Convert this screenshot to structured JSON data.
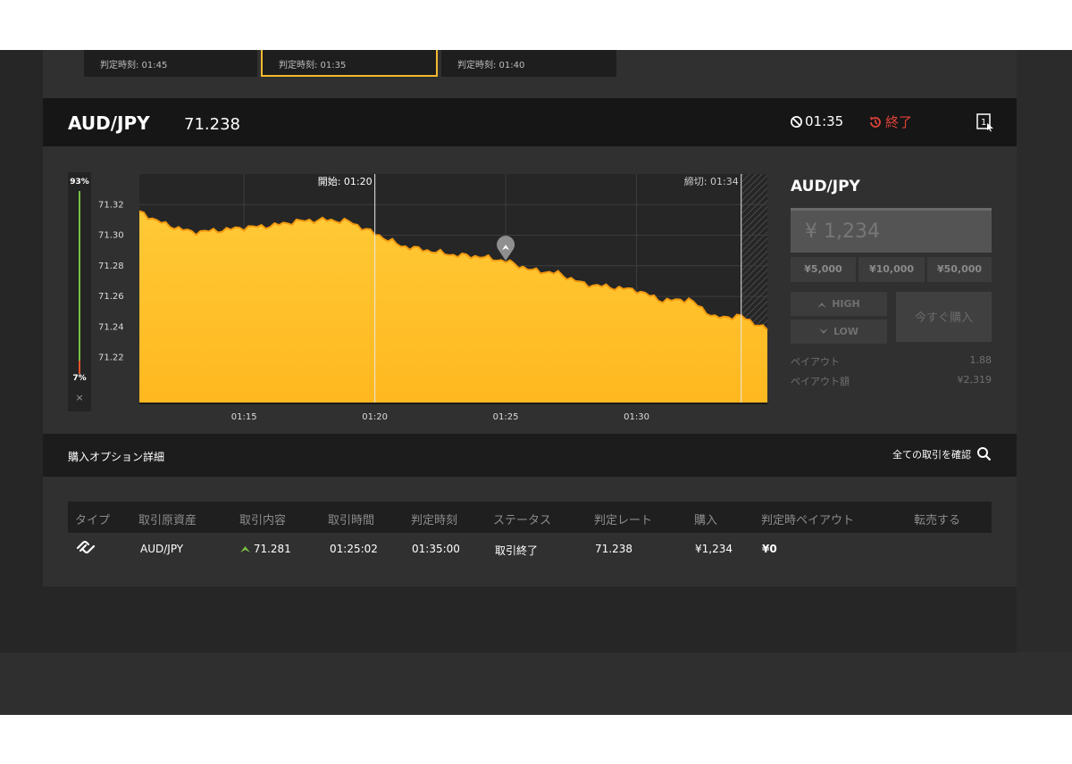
{
  "cards": [
    {
      "label": "判定時刻: 01:45"
    },
    {
      "label": "判定時刻: 01:35",
      "active": true
    },
    {
      "label": "判定時刻: 01:40"
    }
  ],
  "header": {
    "pair": "AUD/JPY",
    "price": "71.238",
    "timer": "01:35",
    "status": "終了",
    "status_color": "#e0433a"
  },
  "gauge": {
    "high_pct": "93%",
    "low_pct": "7%",
    "close": "×"
  },
  "chart_data": {
    "type": "area",
    "x": [
      "01:11",
      "01:12",
      "01:13",
      "01:14",
      "01:15",
      "01:16",
      "01:17",
      "01:18",
      "01:19",
      "01:20",
      "01:21",
      "01:22",
      "01:23",
      "01:24",
      "01:25",
      "01:26",
      "01:27",
      "01:28",
      "01:29",
      "01:30",
      "01:31",
      "01:32",
      "01:33",
      "01:34",
      "01:35"
    ],
    "values": [
      71.315,
      71.307,
      71.302,
      71.303,
      71.305,
      71.306,
      71.309,
      71.31,
      71.309,
      71.301,
      71.293,
      71.29,
      71.287,
      71.286,
      71.283,
      71.277,
      71.275,
      71.268,
      71.266,
      71.264,
      71.257,
      71.258,
      71.246,
      71.247,
      71.238
    ],
    "ylim": [
      71.19,
      71.34
    ],
    "y_ticks": [
      "71.32",
      "71.30",
      "71.28",
      "71.26",
      "71.24",
      "71.22"
    ],
    "x_ticks": [
      "01:15",
      "01:20",
      "01:25",
      "01:30"
    ],
    "start_label": "開始: 01:20",
    "deadline_label": "締切: 01:34",
    "entry_marker": {
      "x": "01:25",
      "value": 71.281,
      "direction": "high"
    },
    "fill_color": "#ffc936",
    "line_color": "#f29a10",
    "grid": true
  },
  "trade_panel": {
    "title": "AUD/JPY",
    "amount": "¥ 1,234",
    "presets": [
      "¥5,000",
      "¥10,000",
      "¥50,000"
    ],
    "high": "HIGH",
    "low": "LOW",
    "buy_now": "今すぐ購入",
    "payout_label": "ペイアウト",
    "payout_value": "1.88",
    "payout_amount_label": "ペイアウト額",
    "payout_amount_value": "¥2,319"
  },
  "details": {
    "title": "購入オプション詳細",
    "all_trades": "全ての取引を確認",
    "columns": [
      "タイプ",
      "取引原資産",
      "取引内容",
      "取引時間",
      "判定時刻",
      "ステータス",
      "判定レート",
      "購入",
      "判定時ペイアウト",
      "転売する"
    ],
    "row": {
      "asset": "AUD/JPY",
      "entry_rate": "71.281",
      "trade_time": "01:25:02",
      "judge_time": "01:35:00",
      "status": "取引終了",
      "judge_rate": "71.238",
      "purchase": "¥1,234",
      "payout": "¥0"
    }
  }
}
